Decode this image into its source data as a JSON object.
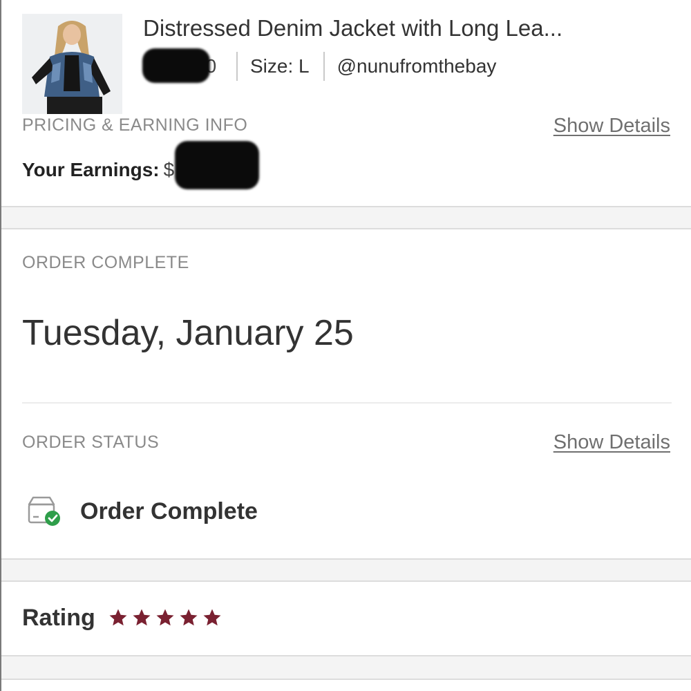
{
  "product": {
    "title": "Distressed Denim Jacket with Long Lea...",
    "price_visible_fragment": "00",
    "size": "Size: L",
    "seller_handle": "@nunufromthebay",
    "thumbnail": "product-photo"
  },
  "pricing": {
    "section_label": "PRICING & EARNING INFO",
    "show_details": "Show Details",
    "earnings_label": "Your Earnings:",
    "earnings_visible_fragment": "$ 00"
  },
  "order": {
    "section_label": "ORDER COMPLETE",
    "date": "Tuesday, January 25"
  },
  "status": {
    "section_label": "ORDER STATUS",
    "show_details": "Show Details",
    "value": "Order Complete",
    "icon": "package-check-icon"
  },
  "rating": {
    "label": "Rating",
    "stars": 5,
    "max_stars": 5,
    "star_color": "#7a2131"
  },
  "colors": {
    "check_green": "#2e9e4a",
    "star": "#7a2131",
    "band": "#f4f4f4"
  }
}
